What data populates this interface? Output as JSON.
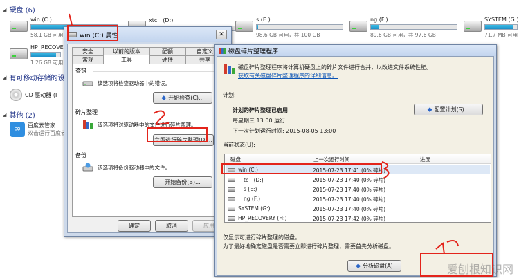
{
  "explorer": {
    "hard_disks_header": "硬盘 (6)",
    "removable_header": "有可移动存储的设",
    "other_header": "其他 (2)",
    "drives": [
      {
        "name": "win (C:)",
        "free_text": "58.1 GB 可用",
        "usage": 0.55
      },
      {
        "name": "xtc　(D:)",
        "free_text": "",
        "usage": 0.5
      },
      {
        "name": "s (E:)",
        "free_text": "98.6 GB 可用，共 100 GB",
        "usage": 0.02
      },
      {
        "name": "ng (F:)",
        "free_text": "89.6 GB 可用，共 97.6 GB",
        "usage": 0.1
      },
      {
        "name": "SYSTEM (G:)",
        "free_text": "71.7 MB 可用",
        "usage": 0.9
      },
      {
        "name": "HP_RECOVER",
        "free_text": "1.26 GB 可用",
        "usage": 0.85
      }
    ],
    "cd_drive": "CD 驱动器 (I",
    "cloud_name": "百度云管家",
    "cloud_desc": "双击运行百度云"
  },
  "properties": {
    "title": "win (C:) 属性",
    "tabs_row1": [
      "安全",
      "以前的版本",
      "配额",
      "自定义"
    ],
    "tabs_row2": [
      "常规",
      "工具",
      "硬件",
      "共享"
    ],
    "check_title": "查错",
    "check_text": "该选项将检查驱动器中的错误。",
    "check_button": "开始检查(C)...",
    "defrag_title": "碎片整理",
    "defrag_text": "该选项将对驱动器中的文件进行碎片整理。",
    "defrag_button": "立即进行碎片整理(D)...",
    "backup_title": "备份",
    "backup_text": "该选项将备份驱动器中的文件。",
    "backup_button": "开始备份(B)...",
    "ok": "确定",
    "cancel": "取消",
    "apply": "应用"
  },
  "defrag": {
    "title": "磁盘碎片整理程序",
    "intro": "磁盘碎片整理程序将计算机硬盘上的碎片文件进行合并，以改进文件系统性能。",
    "link": "获取有关磁盘碎片整理程序的详细信息。",
    "schedule_label": "计划:",
    "schedule_status": "计划的碎片整理已启用",
    "schedule_time": "每星期三 13:00 运行",
    "next_run": "下一次计划运行时间: 2015-08-05 13:00",
    "config_button": "配置计划(S)...",
    "current_status": "当前状态(U):",
    "columns": [
      "磁盘",
      "上一次运行时间",
      "进度"
    ],
    "rows": [
      {
        "disk": "win (C:)",
        "last_run": "2015-07-23 17:41 (0% 碎片)"
      },
      {
        "disk": "tc　(D:)",
        "last_run": "2015-07-23 17:40 (0% 碎片)"
      },
      {
        "disk": "s (E:)",
        "last_run": "2015-07-23 17:40 (0% 碎片)"
      },
      {
        "disk": "ng (F:)",
        "last_run": "2015-07-23 17:40 (0% 碎片)"
      },
      {
        "disk": "SYSTEM (G:)",
        "last_run": "2015-07-23 17:40 (0% 碎片)"
      },
      {
        "disk": "HP_RECOVERY (H:)",
        "last_run": "2015-07-23 17:42 (0% 碎片)"
      }
    ],
    "note1": "仅显示可进行碎片整理的磁盘。",
    "note2": "为了最好地确定磁盘是否需要立即进行碎片整理，需要首先分析磁盘。",
    "analyze_button": "分析磁盘(A)"
  },
  "watermark": "爱刨根知识网"
}
